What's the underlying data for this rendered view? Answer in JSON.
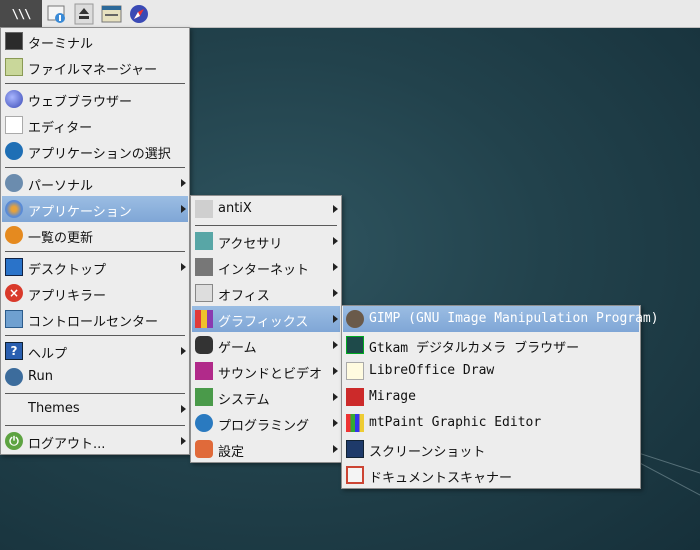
{
  "taskbar": {
    "start_label": "\\\\\\",
    "launchers": [
      "file-manager-icon",
      "eject-icon",
      "window-manager-icon",
      "web-browser-icon"
    ]
  },
  "main_menu": {
    "items": [
      {
        "label": "ターミナル",
        "icon": "terminal-icon"
      },
      {
        "label": "ファイルマネージャー",
        "icon": "file-manager-icon"
      },
      {
        "label": "ウェブブラウザー",
        "icon": "web-browser-icon"
      },
      {
        "label": "エディター",
        "icon": "text-editor-icon"
      },
      {
        "label": "アプリケーションの選択",
        "icon": "app-finder-icon"
      },
      {
        "label": "パーソナル",
        "icon": "personal-icon"
      },
      {
        "label": "アプリケーション",
        "icon": "applications-icon"
      },
      {
        "label": "一覧の更新",
        "icon": "refresh-icon"
      },
      {
        "label": "デスクトップ",
        "icon": "desktop-icon"
      },
      {
        "label": "アプリキラー",
        "icon": "app-killer-icon"
      },
      {
        "label": "コントロールセンター",
        "icon": "control-center-icon"
      },
      {
        "label": "ヘルプ",
        "icon": "help-icon"
      },
      {
        "label": "Run",
        "icon": "run-gear-icon"
      },
      {
        "label": "Themes",
        "icon": ""
      },
      {
        "label": "ログアウト...",
        "icon": "logout-icon"
      }
    ]
  },
  "applications_menu": {
    "items": [
      {
        "label": "antiX",
        "icon": "antix-icon"
      },
      {
        "label": "アクセサリ",
        "icon": "accessories-icon"
      },
      {
        "label": "インターネット",
        "icon": "internet-icon"
      },
      {
        "label": "オフィス",
        "icon": "office-icon"
      },
      {
        "label": "グラフィックス",
        "icon": "graphics-icon"
      },
      {
        "label": "ゲーム",
        "icon": "games-icon"
      },
      {
        "label": "サウンドとビデオ",
        "icon": "multimedia-icon"
      },
      {
        "label": "システム",
        "icon": "system-icon"
      },
      {
        "label": "プログラミング",
        "icon": "programming-icon"
      },
      {
        "label": "設定",
        "icon": "settings-icon"
      }
    ]
  },
  "graphics_menu": {
    "items": [
      {
        "label": "GIMP (GNU Image Manipulation Program)",
        "icon": "gimp-icon"
      },
      {
        "label": "Gtkam デジタルカメラ ブラウザー",
        "icon": "gtkam-icon"
      },
      {
        "label": "LibreOffice Draw",
        "icon": "libreoffice-draw-icon"
      },
      {
        "label": "Mirage",
        "icon": "mirage-icon"
      },
      {
        "label": "mtPaint Graphic Editor",
        "icon": "mtpaint-icon"
      },
      {
        "label": "スクリーンショット",
        "icon": "screenshot-icon"
      },
      {
        "label": "ドキュメントスキャナー",
        "icon": "document-scanner-icon"
      }
    ]
  },
  "colors": {
    "menu_bg": "#ededed",
    "highlight": "#8fb3df",
    "wallpaper": "#22424c",
    "taskbar_bg": "#e9e9e9"
  }
}
